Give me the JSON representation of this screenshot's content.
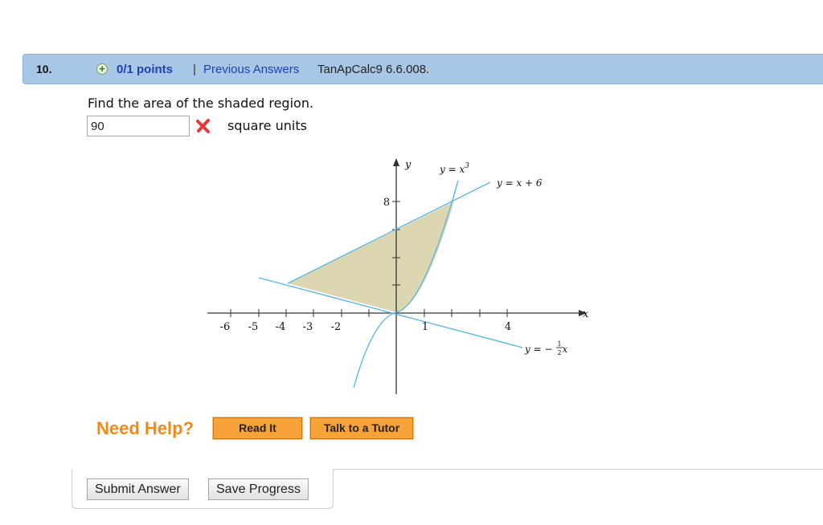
{
  "question": {
    "number": "10.",
    "points": "0/1 points",
    "separator": "|",
    "previous_answers": "Previous Answers",
    "code": "TanApCalc9 6.6.008."
  },
  "prompt": "Find the area of the shaded region.",
  "answer": {
    "value": "90",
    "status": "incorrect",
    "units": "square units"
  },
  "figure": {
    "x_axis_label": "x",
    "y_axis_label": "y",
    "x_tick_labels": [
      "-6",
      "-5",
      "-4",
      "-3",
      "-2",
      "1",
      "4"
    ],
    "y_tick_labels": [
      "8"
    ],
    "curve_labels": {
      "cubic": "y = x",
      "cubic_exp": "3",
      "line": "y = x + 6",
      "neg_half": "y = −",
      "neg_half_x": "x"
    },
    "colors": {
      "curve": "#5bb6e6",
      "shade": "#ddd7b1",
      "axis": "#333333"
    }
  },
  "help": {
    "label": "Need Help?",
    "read_it": "Read It",
    "tutor": "Talk to a Tutor"
  },
  "actions": {
    "submit": "Submit Answer",
    "save": "Save Progress"
  }
}
